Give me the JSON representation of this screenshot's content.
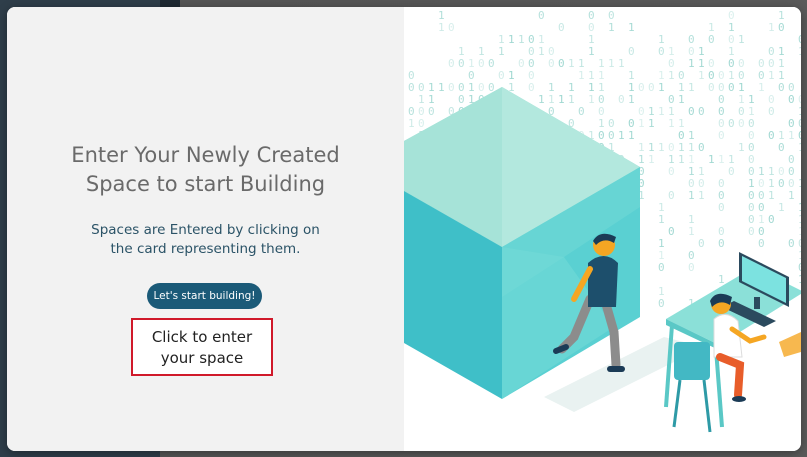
{
  "modal": {
    "title_line1": "Enter Your Newly Created",
    "title_line2": "Space to start Building",
    "subtitle_line1": "Spaces are Entered by clicking on",
    "subtitle_line2": "the card representing them.",
    "start_button_label": "Let's start building!",
    "callout_line1": "Click to enter",
    "callout_line2": "your space"
  },
  "colors": {
    "button": "#1b5a78",
    "callout_border": "#d0192a",
    "cube_top": "#9fe0d5",
    "cube_side": "#48c8cc",
    "accent": "#f5a623"
  },
  "illustration": {
    "name": "binary-rain-cube-and-developer-illustration",
    "icons": [
      "cube-illustration",
      "walking-person-illustration",
      "developer-at-desk-illustration",
      "monitor-icon",
      "binary-code-background"
    ]
  }
}
